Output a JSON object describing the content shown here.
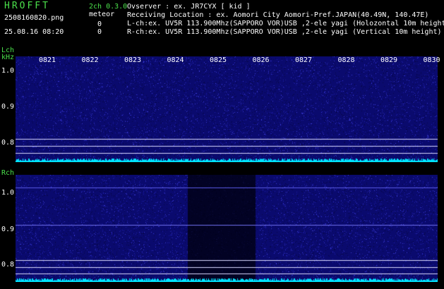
{
  "header": {
    "logo": "HROFFT",
    "channel_info": "2ch 0.3.0",
    "filename": "2508160820.png",
    "meteor_label": "meteor",
    "count_l": "0",
    "count_r": "0",
    "datetime": "25.08.16 08:20",
    "observer": "Ovserver               : ex. JR7CYX [ kid ]",
    "location": "Receiving Location : ex. Aomori City Aomori-Pref.JAPAN(40.49N, 140.47E)",
    "lch_info": "L-ch:ex. UV5R 113.900Mhz(SAPPORO VOR)USB ,2-ele yagi (Holozontal 10m height",
    "rch_info": "R-ch:ex. UV5R 113.900Mhz(SAPPORO VOR)USB ,2-ele yagi (Vertical 10m height)"
  },
  "lch": {
    "label": "Lch",
    "unit": "kHz",
    "y_labels": [
      "1.0",
      "0.9",
      "0.8"
    ]
  },
  "rch": {
    "label": "Rch",
    "y_labels": [
      "1.0",
      "0.9",
      "0.8"
    ]
  },
  "time_ticks": [
    "0821",
    "0822",
    "0823",
    "0824",
    "0825",
    "0826",
    "0827",
    "0828",
    "0829",
    "0830"
  ],
  "colors": {
    "background": "#000000",
    "panel": "#0a0a6e",
    "label_green": "#4be04b",
    "baseline": "#00e5ff"
  }
}
